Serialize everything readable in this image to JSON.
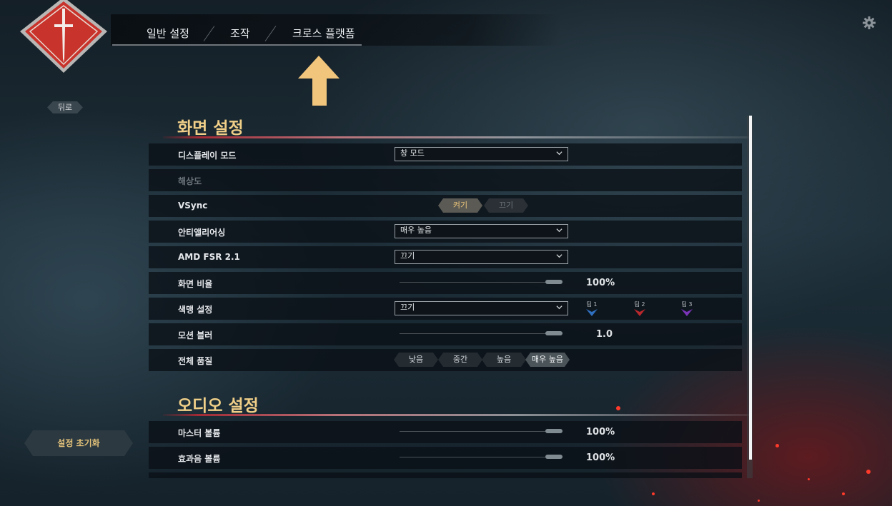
{
  "nav": {
    "tabs": [
      {
        "label": "일반 설정"
      },
      {
        "label": "조작"
      },
      {
        "label": "크로스 플랫폼"
      }
    ]
  },
  "sidebar": {
    "back_label": "뒤로",
    "reset_label": "설정 초기화"
  },
  "display": {
    "title": "화면 설정",
    "display_mode": {
      "label": "디스플레이 모드",
      "value": "창 모드"
    },
    "resolution": {
      "label": "해상도"
    },
    "vsync": {
      "label": "VSync",
      "on": "켜기",
      "off": "끄기",
      "selected": "켜기"
    },
    "antialiasing": {
      "label": "안티앨리어싱",
      "value": "매우 높음"
    },
    "fsr": {
      "label": "AMD FSR 2.1",
      "value": "끄기"
    },
    "screen_ratio": {
      "label": "화면 비율",
      "value": "100%",
      "level": 1.0
    },
    "colorblind": {
      "label": "색맹 설정",
      "value": "끄기",
      "teams": [
        {
          "label": "팀 1",
          "color": "#2f6fbf"
        },
        {
          "label": "팀 2",
          "color": "#b8282c"
        },
        {
          "label": "팀 3",
          "color": "#7a34b8"
        }
      ]
    },
    "motion_blur": {
      "label": "모션 블러",
      "value": "1.0",
      "level": 1.0
    },
    "overall_quality": {
      "label": "전체 품질",
      "options": [
        "낮음",
        "중간",
        "높음",
        "매우 높음"
      ],
      "selected": "매우 높음"
    }
  },
  "audio": {
    "title": "오디오 설정",
    "master_volume": {
      "label": "마스터 볼륨",
      "value": "100%",
      "level": 1.0
    },
    "effects_volume": {
      "label": "효과음 볼륨",
      "value": "100%",
      "level": 1.0
    }
  },
  "colors": {
    "accent_gold": "#f0cf88",
    "accent_red": "#c0392b",
    "panel": "#0a1016"
  },
  "icons": [
    "game-logo-icon",
    "up-arrow-icon",
    "gear-icon",
    "chevron-down-icon",
    "team-marker-icon"
  ]
}
